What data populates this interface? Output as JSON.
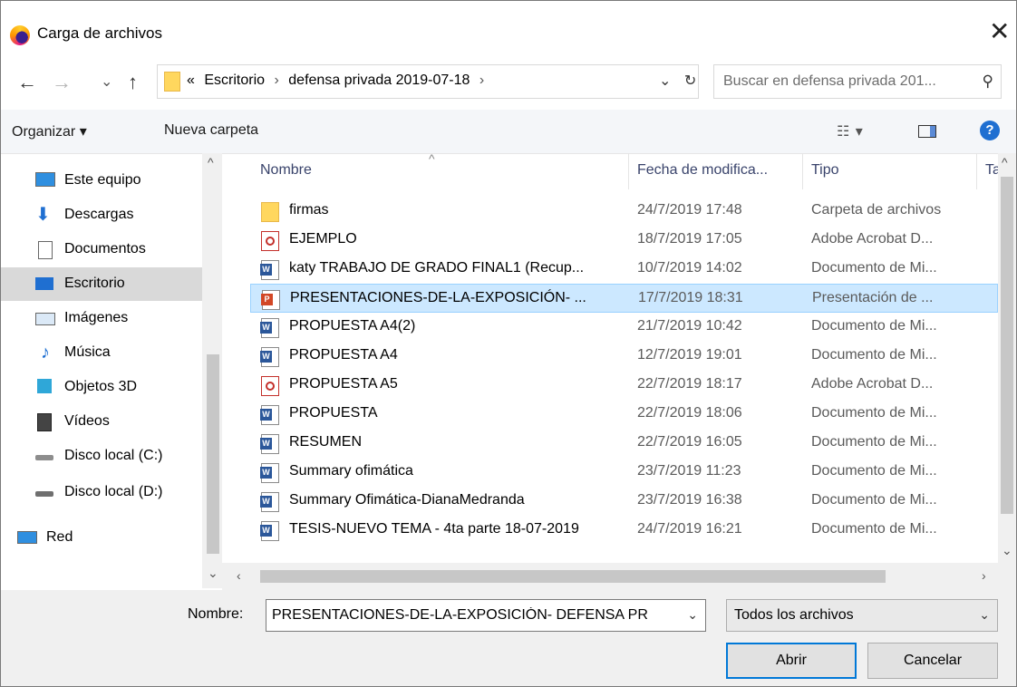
{
  "window": {
    "title": "Carga de archivos",
    "close_glyph": "✕"
  },
  "nav": {
    "back": "←",
    "forward": "→",
    "recent": "⌄",
    "up": "↑"
  },
  "address": {
    "overflow": "«",
    "crumbs": [
      "Escritorio",
      "defensa privada 2019-07-18"
    ],
    "separator": "›",
    "dropdown": "⌄",
    "refresh": "↻"
  },
  "search": {
    "placeholder": "Buscar en defensa privada 201...",
    "icon": "search-icon"
  },
  "toolbar": {
    "organize": "Organizar ▾",
    "new_folder": "Nueva carpeta",
    "view_glyph": "☷ ▾",
    "help": "?"
  },
  "sidebar": {
    "items": [
      {
        "label": "Este equipo",
        "icon": "computer-icon"
      },
      {
        "label": "Descargas",
        "icon": "download-icon"
      },
      {
        "label": "Documentos",
        "icon": "documents-icon"
      },
      {
        "label": "Escritorio",
        "icon": "desktop-icon",
        "selected": true
      },
      {
        "label": "Imágenes",
        "icon": "pictures-icon"
      },
      {
        "label": "Música",
        "icon": "music-icon"
      },
      {
        "label": "Objetos 3D",
        "icon": "objects-3d-icon"
      },
      {
        "label": "Vídeos",
        "icon": "videos-icon"
      },
      {
        "label": "Disco local (C:)",
        "icon": "drive-c-icon"
      },
      {
        "label": "Disco local (D:)",
        "icon": "drive-d-icon"
      },
      {
        "label": "Red",
        "icon": "network-icon"
      }
    ]
  },
  "columns": {
    "name": "Nombre",
    "date": "Fecha de modifica...",
    "type": "Tipo",
    "size": "Ta"
  },
  "files": [
    {
      "name": "firmas",
      "date": "24/7/2019 17:48",
      "type": "Carpeta de archivos",
      "icon": "folder"
    },
    {
      "name": "EJEMPLO",
      "date": "18/7/2019 17:05",
      "type": "Adobe Acrobat D...",
      "icon": "pdf"
    },
    {
      "name": "katy TRABAJO DE GRADO FINAL1 (Recup...",
      "date": "10/7/2019 14:02",
      "type": "Documento de Mi...",
      "icon": "word"
    },
    {
      "name": "PRESENTACIONES-DE-LA-EXPOSICIÓN- ...",
      "date": "17/7/2019 18:31",
      "type": "Presentación de ...",
      "icon": "ppt",
      "selected": true
    },
    {
      "name": "PROPUESTA A4(2)",
      "date": "21/7/2019 10:42",
      "type": "Documento de Mi...",
      "icon": "word"
    },
    {
      "name": "PROPUESTA A4",
      "date": "12/7/2019 19:01",
      "type": "Documento de Mi...",
      "icon": "word"
    },
    {
      "name": "PROPUESTA A5",
      "date": "22/7/2019 18:17",
      "type": "Adobe Acrobat D...",
      "icon": "pdf"
    },
    {
      "name": "PROPUESTA",
      "date": "22/7/2019 18:06",
      "type": "Documento de Mi...",
      "icon": "word"
    },
    {
      "name": "RESUMEN",
      "date": "22/7/2019 16:05",
      "type": "Documento de Mi...",
      "icon": "word"
    },
    {
      "name": "Summary ofimática",
      "date": "23/7/2019 11:23",
      "type": "Documento de Mi...",
      "icon": "word"
    },
    {
      "name": "Summary Ofimática-DianaMedranda",
      "date": "23/7/2019 16:38",
      "type": "Documento de Mi...",
      "icon": "word"
    },
    {
      "name": "TESIS-NUEVO TEMA - 4ta parte 18-07-2019",
      "date": "24/7/2019 16:21",
      "type": "Documento de Mi...",
      "icon": "word"
    }
  ],
  "footer": {
    "name_label": "Nombre:",
    "file_name": "PRESENTACIONES-DE-LA-EXPOSICIÓN- DEFENSA PR",
    "filter": "Todos los archivos",
    "open": "Abrir",
    "cancel": "Cancelar"
  }
}
